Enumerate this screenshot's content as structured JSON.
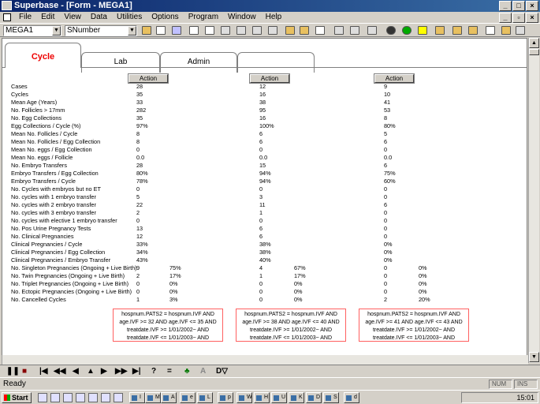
{
  "window": {
    "title": "Superbase - [Form - MEGA1]"
  },
  "menu": [
    "File",
    "Edit",
    "View",
    "Data",
    "Utilities",
    "Options",
    "Program",
    "Window",
    "Help"
  ],
  "toolbar": {
    "table_combo": "MEGA1",
    "field_combo": "SNumber"
  },
  "tabs": [
    "Cycle",
    "Lab",
    "Admin",
    ""
  ],
  "action_label": "Action",
  "rows": [
    {
      "label": "Cases",
      "c1": "28",
      "c2": "12",
      "c3": "9"
    },
    {
      "label": "Cycles",
      "c1": "35",
      "c2": "16",
      "c3": "10"
    },
    {
      "label": "Mean Age (Years)",
      "c1": "33",
      "c2": "38",
      "c3": "41"
    },
    {
      "label": "No. Follicles > 17mm",
      "c1": "282",
      "c2": "95",
      "c3": "53"
    },
    {
      "label": "No. Egg Collections",
      "c1": "35",
      "c2": "16",
      "c3": "8"
    },
    {
      "label": "Egg Collections / Cycle (%)",
      "c1": "97%",
      "c2": "100%",
      "c3": "80%"
    },
    {
      "label": "Mean No. Follicles / Cycle",
      "c1": "8",
      "c2": "6",
      "c3": "5"
    },
    {
      "label": "Mean No. Follicles / Egg Collection",
      "c1": "8",
      "c2": "6",
      "c3": "6"
    },
    {
      "label": "Mean No. eggs / Egg Collection",
      "c1": "0",
      "c2": "0",
      "c3": "0"
    },
    {
      "label": "Mean No. eggs / Follicle",
      "c1": "0.0",
      "c2": "0.0",
      "c3": "0.0"
    },
    {
      "label": "No. Embryo Transfers",
      "c1": "28",
      "c2": "15",
      "c3": "6"
    },
    {
      "label": "Embryo Transfers / Egg Collection",
      "c1": "80%",
      "c2": "94%",
      "c3": "75%"
    },
    {
      "label": "Embryo Transfers / Cycle",
      "c1": "78%",
      "c2": "94%",
      "c3": "60%"
    },
    {
      "label": "No. Cycles with embryos but no ET",
      "c1": "0",
      "c2": "0",
      "c3": "0"
    },
    {
      "label": "No. cycles with 1 embryo transfer",
      "c1": "5",
      "c2": "3",
      "c3": "0"
    },
    {
      "label": "No. cycles with 2 embryo transfer",
      "c1": "22",
      "c2": "11",
      "c3": "6"
    },
    {
      "label": "No. cycles with 3 embryo transfer",
      "c1": "2",
      "c2": "1",
      "c3": "0"
    },
    {
      "label": "No. cycles with elective 1 embryo transfer",
      "c1": "0",
      "c2": "0",
      "c3": "0"
    },
    {
      "label": "No. Pos Urine Pregnancy Tests",
      "c1": "13",
      "c2": "6",
      "c3": "0"
    },
    {
      "label": "No. Clinical Pregnancies",
      "c1": "12",
      "c2": "6",
      "c3": "0"
    },
    {
      "label": "Clinical Pregnancies / Cycle",
      "c1": "33%",
      "c2": "38%",
      "c3": "0%"
    },
    {
      "label": "Clinical Pregnancies / Egg Collection",
      "c1": "34%",
      "c2": "38%",
      "c3": "0%"
    },
    {
      "label": "Clinical Pregnancies / Embryo Transfer",
      "c1": "43%",
      "c2": "40%",
      "c3": "0%"
    },
    {
      "label": "No. Singleton Pregnancies (Ongoing + Live Birth)",
      "c1": "9",
      "p1": "75%",
      "c2": "4",
      "p2": "67%",
      "c3": "0",
      "p3": "0%"
    },
    {
      "label": "No. Twin Pregnancies (Ongoing + Live Birth)",
      "c1": "2",
      "p1": "17%",
      "c2": "1",
      "p2": "17%",
      "c3": "0",
      "p3": "0%"
    },
    {
      "label": "No. Triplet Pregnancies (Ongoing + Live Birth)",
      "c1": "0",
      "p1": "0%",
      "c2": "0",
      "p2": "0%",
      "c3": "0",
      "p3": "0%"
    },
    {
      "label": "No. Ectopic Pregnancies (Ongoing + Live Birth)",
      "c1": "0",
      "p1": "0%",
      "c2": "0",
      "p2": "0%",
      "c3": "0",
      "p3": "0%"
    },
    {
      "label": "No. Cancelled Cycles",
      "c1": "1",
      "p1": "3%",
      "c2": "0",
      "p2": "0%",
      "c3": "2",
      "p3": "20%"
    }
  ],
  "queries": [
    [
      "hospnum.PATS2 = hospnum.IVF AND",
      "age.IVF >= 32 AND age.IVF <= 35 AND",
      "treatdate.IVF >= 1/01/2002~ AND",
      "treatdate.IVF <= 1/01/2003~ AND"
    ],
    [
      "hospnum.PATS2 = hospnum.IVF AND",
      "age.IVF >= 38 AND age.IVF <= 40 AND",
      "treatdate.IVF >= 1/01/2002~ AND",
      "treatdate.IVF <= 1/01/2003~ AND"
    ],
    [
      "hospnum.PATS2 = hospnum.IVF AND",
      "age.IVF >= 41 AND age.IVF <= 43 AND",
      "treatdate.IVF >= 1/01/2002~ AND",
      "treatdate.IVF <= 1/01/2003~ AND"
    ]
  ],
  "nav": {
    "query": "?",
    "equals": "="
  },
  "status": {
    "text": "Ready",
    "num": "NUM",
    "ins": "INS"
  },
  "taskbar": {
    "start": "Start",
    "clock": "15:01",
    "items": [
      "I",
      "M",
      "A",
      "e",
      "L",
      "p",
      "W",
      "H",
      "U",
      "K",
      "D",
      "S",
      "d"
    ]
  }
}
